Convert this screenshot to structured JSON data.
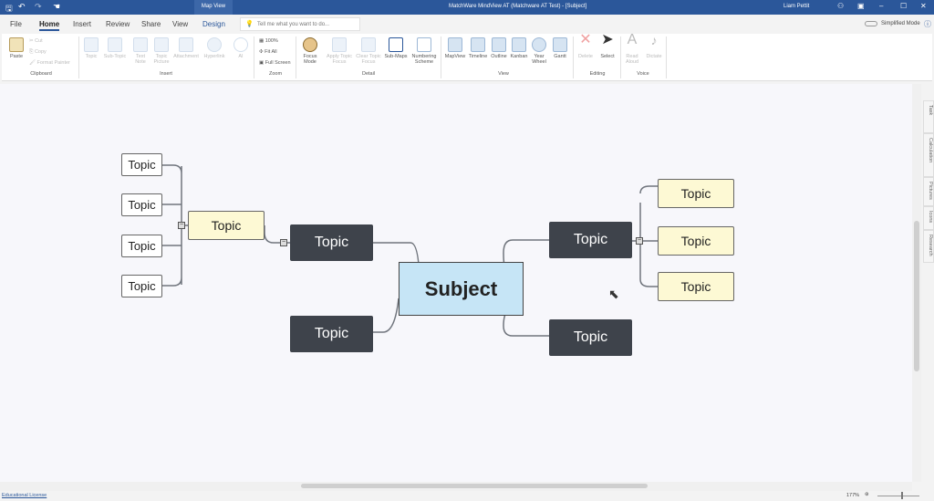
{
  "titlebar": {
    "context_tab": "Map View",
    "title": "MatchWare MindView AT (Matchware AT Test) - [Subject]",
    "user": "Liam Pettit"
  },
  "tabs": [
    "File",
    "Home",
    "Insert",
    "Review",
    "Share",
    "View",
    "Design"
  ],
  "search": {
    "placeholder": "Tell me what you want to do..."
  },
  "simplified_mode": "Simplified Mode",
  "ribbon": {
    "clipboard": {
      "paste": "Paste",
      "cut": "Cut",
      "copy": "Copy",
      "format_painter": "Format Painter",
      "label": "Clipboard"
    },
    "insert": {
      "topic": "Topic",
      "sub_topic": "Sub-Topic",
      "text_note": "Text Note",
      "topic_picture": "Topic Picture",
      "attachment": "Attachment",
      "hyperlink": "Hyperlink",
      "ai": "AI",
      "label": "Insert"
    },
    "zoom": {
      "zoom100": "100%",
      "fit_all": "Fit All",
      "full_screen": "Full Screen",
      "label": "Zoom"
    },
    "detail": {
      "focus_mode": "Focus Mode",
      "apply_topic_focus": "Apply Topic Focus",
      "clear_topic_focus": "Clear Topic Focus",
      "sub_maps": "Sub-Maps",
      "numbering_scheme": "Numbering Scheme",
      "label": "Detail"
    },
    "view": {
      "mapview": "MapView",
      "timeline": "Timeline",
      "outline": "Outline",
      "kanban": "Kanban",
      "year_wheel": "Year Wheel",
      "gantt": "Gantt",
      "label": "View"
    },
    "editing": {
      "delete": "Delete",
      "select": "Select",
      "label": "Editing"
    },
    "voice": {
      "read_aloud": "Read Aloud",
      "dictate": "Dictate",
      "label": "Voice"
    }
  },
  "map": {
    "subject": "Subject",
    "left_topics": [
      "Topic",
      "Topic"
    ],
    "right_topics": [
      "Topic",
      "Topic"
    ],
    "left_subtopic": "Topic",
    "left_leaves": [
      "Topic",
      "Topic",
      "Topic",
      "Topic"
    ],
    "right_leaves": [
      "Topic",
      "Topic",
      "Topic"
    ]
  },
  "side_panel": [
    "Task",
    "Calculation",
    "Pictures",
    "Icons",
    "Research"
  ],
  "status": {
    "license": "Educational License",
    "zoom": "177%"
  },
  "colors": {
    "titlebar": "#2b579a",
    "dark_topic": "#3e434b",
    "subject": "#c6e5f6",
    "yellow_topic": "#fdf9d4"
  }
}
